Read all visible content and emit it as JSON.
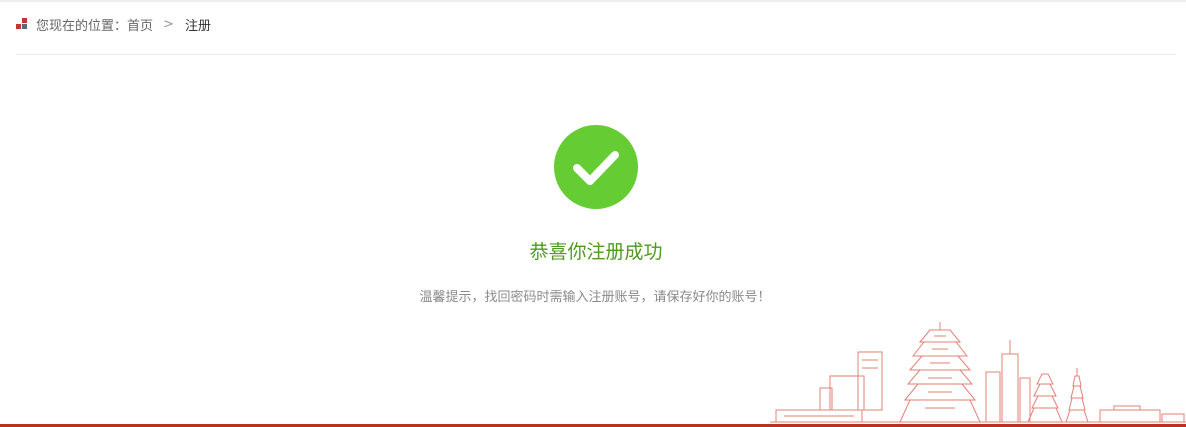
{
  "breadcrumb": {
    "prefix": "您现在的位置：",
    "home": "首页",
    "separator": ">",
    "current": "注册"
  },
  "result": {
    "icon": "check-circle-icon",
    "title": "恭喜你注册成功",
    "tip": "温馨提示，找回密码时需输入注册账号，请保存好你的账号！"
  },
  "colors": {
    "success_green": "#66cc33",
    "title_green": "#4f9a1f",
    "brand_red": "#b8321f",
    "skyline_red": "#d9534f"
  }
}
